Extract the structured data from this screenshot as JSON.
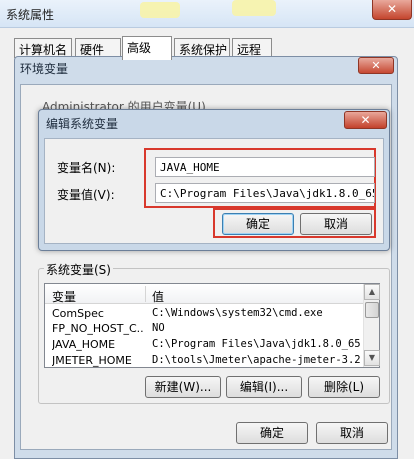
{
  "outer_window": {
    "title": "系统属性",
    "tabs": [
      "计算机名",
      "硬件",
      "高级",
      "系统保护",
      "远程"
    ]
  },
  "env_window": {
    "title": "环境变量",
    "user_vars_label_partial": "Administrator 的用户变量(U)",
    "system_vars_label": "系统变量(S)",
    "list_headers": [
      "变量",
      "值"
    ],
    "rows": [
      {
        "name": "ComSpec",
        "value": "C:\\Windows\\system32\\cmd.exe"
      },
      {
        "name": "FP_NO_HOST_C...",
        "value": "NO"
      },
      {
        "name": "JAVA_HOME",
        "value": "C:\\Program Files\\Java\\jdk1.8.0_65"
      },
      {
        "name": "JMETER_HOME",
        "value": "D:\\tools\\Jmeter\\apache-jmeter-3.2"
      }
    ],
    "buttons": {
      "new": "新建(W)...",
      "edit": "编辑(I)...",
      "delete": "删除(L)"
    },
    "ok": "确定",
    "cancel": "取消"
  },
  "edit_dialog": {
    "title": "编辑系统变量",
    "name_label": "变量名(N):",
    "value_label": "变量值(V):",
    "name_value": "JAVA_HOME",
    "value_value": "C:\\Program Files\\Java\\jdk1.8.0_65",
    "ok": "确定",
    "cancel": "取消"
  },
  "colors": {
    "highlight": "#d8382c",
    "title_bar": "#cfdcea"
  },
  "icons": {
    "close": "close-icon",
    "scroll_up": "scroll-up-icon",
    "scroll_down": "scroll-down-icon"
  }
}
